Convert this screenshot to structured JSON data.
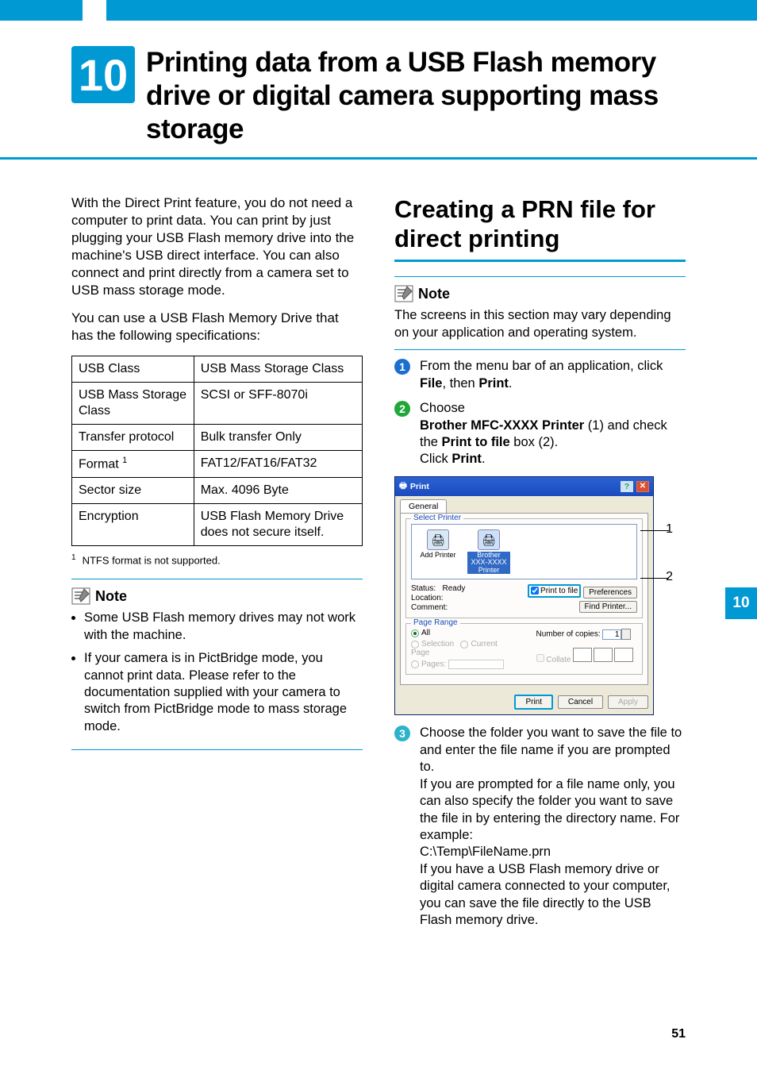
{
  "chapter": {
    "number": "10",
    "title": "Printing data from a USB Flash memory drive or digital camera supporting mass storage"
  },
  "left": {
    "p1": "With the Direct Print feature, you do not need a computer to print data. You can print by just plugging your USB Flash memory drive into the machine's USB direct interface. You can also connect and print directly from a camera set to USB mass storage mode.",
    "p2": "You can use a USB Flash Memory Drive that has the following specifications:",
    "table": {
      "rows": [
        [
          "USB Class",
          "USB Mass Storage Class"
        ],
        [
          "USB Mass Storage Class",
          "SCSI or SFF-8070i"
        ],
        [
          "Transfer protocol",
          "Bulk transfer Only"
        ],
        [
          "Format ",
          "FAT12/FAT16/FAT32"
        ],
        [
          "Sector size",
          "Max. 4096 Byte"
        ],
        [
          "Encryption",
          "USB Flash Memory Drive does not secure itself."
        ]
      ]
    },
    "footnote": "NTFS format is not supported.",
    "footnote_num": "1",
    "note_label": "Note",
    "note_items": [
      "Some USB Flash memory drives may not work with the machine.",
      "If your camera is in PictBridge mode, you cannot print data. Please refer to the documentation supplied with your camera to switch from PictBridge mode to mass storage mode."
    ]
  },
  "right": {
    "section_title": "Creating a PRN file for direct printing",
    "note_label": "Note",
    "note_body": "The screens in this section may vary depending on your application and operating system.",
    "steps": {
      "s1a": "From the menu bar of an application, click ",
      "s1_b1": "File",
      "s1_mid": ", then ",
      "s1_b2": "Print",
      "s1_end": ".",
      "s2a": "Choose",
      "s2_b1": "Brother MFC-XXXX Printer",
      "s2_paren": " (1) and check the ",
      "s2_b2": "Print to file",
      "s2_paren2": " box (2).",
      "s2_click": "Click ",
      "s2_b3": "Print",
      "s2_end": ".",
      "s3_a": "Choose the folder you want to save the file to and enter the file name if you are prompted to.",
      "s3_b": "If you are prompted for a file name only, you can also specify the folder you want to save the file in by entering the directory name. For example:",
      "s3_path": "C:\\Temp\\FileName.prn",
      "s3_c": "If you have a USB Flash memory drive or digital camera connected to your computer, you can save the file directly to the USB Flash memory drive."
    },
    "dialog": {
      "title": "Print",
      "tab": "General",
      "select_printer": "Select Printer",
      "add_printer": "Add Printer",
      "brother": "Brother XXX-XXXX Printer",
      "status": "Status:",
      "status_val": "Ready",
      "location": "Location:",
      "comment": "Comment:",
      "print_to_file": "Print to file",
      "preferences": "Preferences",
      "find_printer": "Find Printer...",
      "page_range": "Page Range",
      "all": "All",
      "selection": "Selection",
      "current_page": "Current Page",
      "pages": "Pages:",
      "copies": "Number of copies:",
      "copies_val": "1",
      "collate": "Collate",
      "btn_print": "Print",
      "btn_cancel": "Cancel",
      "btn_apply": "Apply",
      "lead1": "1",
      "lead2": "2"
    }
  },
  "side_tab": "10",
  "page_number": "51"
}
